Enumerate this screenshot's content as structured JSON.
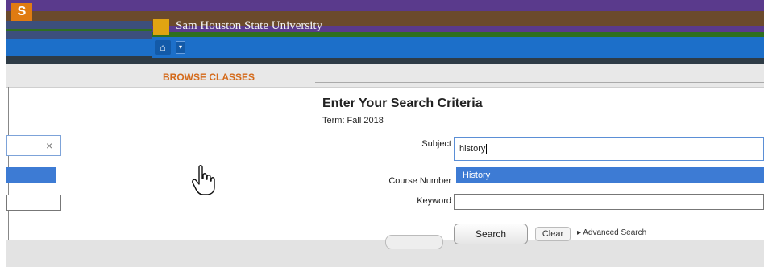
{
  "background_window": {
    "logo_letter": "S",
    "clear_icon": "×"
  },
  "header": {
    "university_name": "Sam Houston State University"
  },
  "nav": {
    "home_icon": "home-icon",
    "dropdown_icon": "chevron-down-icon"
  },
  "tab": {
    "label": "BROWSE CLASSES"
  },
  "form": {
    "title": "Enter Your Search Criteria",
    "term": "Term: Fall 2018",
    "subject_label": "Subject",
    "subject_value": "history",
    "subject_option": "History",
    "course_number_label": "Course Number",
    "keyword_label": "Keyword",
    "keyword_value": ""
  },
  "actions": {
    "search_label": "Search",
    "clear_label": "Clear",
    "advanced_label": "▸ Advanced Search"
  },
  "colors": {
    "accent_blue": "#1c6fc9",
    "highlight": "#3d7bd4",
    "brand_orange": "#e07b12"
  },
  "cursor": "pointer-hand-icon"
}
